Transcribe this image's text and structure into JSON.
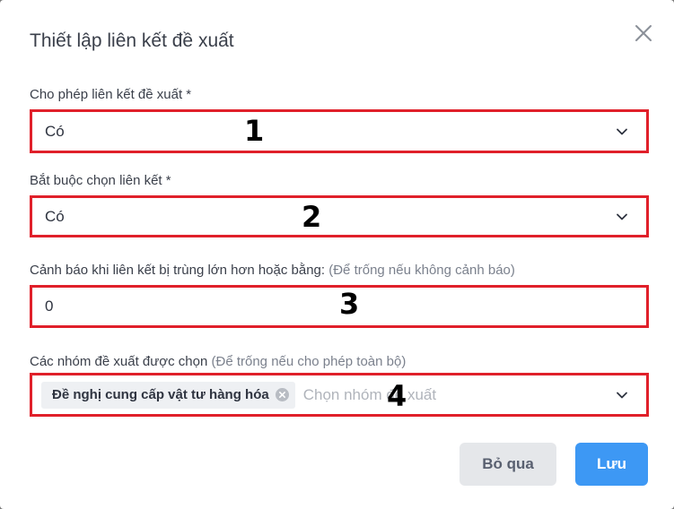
{
  "dialog": {
    "title": "Thiết lập liên kết đề xuất"
  },
  "fields": {
    "allow_link": {
      "label": "Cho phép liên kết đề xuất *",
      "value": "Có",
      "marker": "1"
    },
    "require_link": {
      "label": "Bắt buộc chọn liên kết *",
      "value": "Có",
      "marker": "2"
    },
    "duplicate_warning": {
      "label": "Cảnh báo khi liên kết bị trùng lớn hơn hoặc bằng:",
      "hint": "(Để trống nếu không cảnh báo)",
      "value": "0",
      "marker": "3"
    },
    "groups": {
      "label": "Các nhóm đề xuất được chọn",
      "hint": "(Để trống nếu cho phép toàn bộ)",
      "tags": [
        "Đề nghị cung cấp vật tư hàng hóa"
      ],
      "placeholder": "Chọn nhóm đề xuất",
      "marker": "4"
    }
  },
  "buttons": {
    "cancel": "Bỏ qua",
    "save": "Lưu"
  },
  "colors": {
    "highlight": "#e0202a",
    "primary": "#3d98f4"
  }
}
